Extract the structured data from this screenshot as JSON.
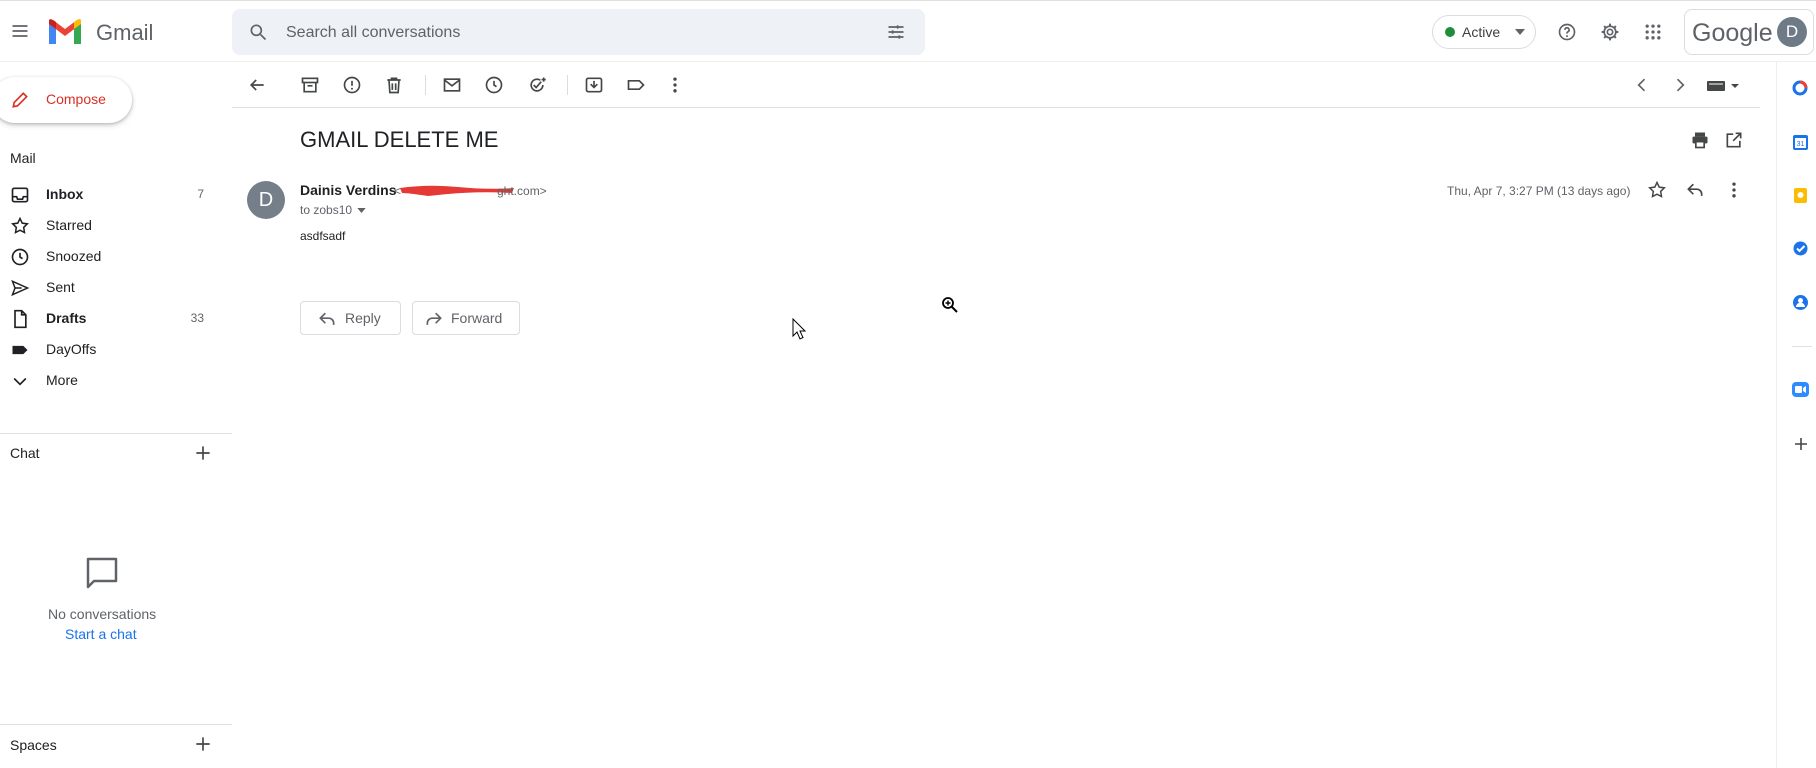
{
  "header": {
    "app_name": "Gmail",
    "search_placeholder": "Search all conversations",
    "status_label": "Active",
    "status_color": "#1e8e3e",
    "google_label": "Google",
    "account_initial": "D"
  },
  "nav": {
    "compose_label": "Compose",
    "mail_section": "Mail",
    "items": [
      {
        "label": "Inbox",
        "count": "7",
        "icon": "inbox-icon",
        "bold": true
      },
      {
        "label": "Starred",
        "count": "",
        "icon": "star-icon",
        "bold": false
      },
      {
        "label": "Snoozed",
        "count": "",
        "icon": "clock-icon",
        "bold": false
      },
      {
        "label": "Sent",
        "count": "",
        "icon": "send-icon",
        "bold": false
      },
      {
        "label": "Drafts",
        "count": "33",
        "icon": "draft-icon",
        "bold": true
      },
      {
        "label": "DayOffs",
        "count": "",
        "icon": "label-icon",
        "bold": false
      },
      {
        "label": "More",
        "count": "",
        "icon": "chevron-down-icon",
        "bold": false
      }
    ],
    "chat_section": "Chat",
    "chat_empty": "No conversations",
    "chat_start": "Start a chat",
    "spaces_section": "Spaces"
  },
  "message": {
    "subject": "GMAIL DELETE ME",
    "sender_name": "Dainis Verdins",
    "sender_email_visible_prefix": "<",
    "sender_email_visible_suffix": "ght.com>",
    "to_line": "to zobs10",
    "date": "Thu, Apr 7, 3:27 PM (13 days ago)",
    "body": "asdfsadf",
    "avatar_initial": "D",
    "reply_label": "Reply",
    "forward_label": "Forward"
  },
  "colors": {
    "compose_accent": "#d93025",
    "link": "#1a73e8",
    "redaction": "#e53935"
  }
}
